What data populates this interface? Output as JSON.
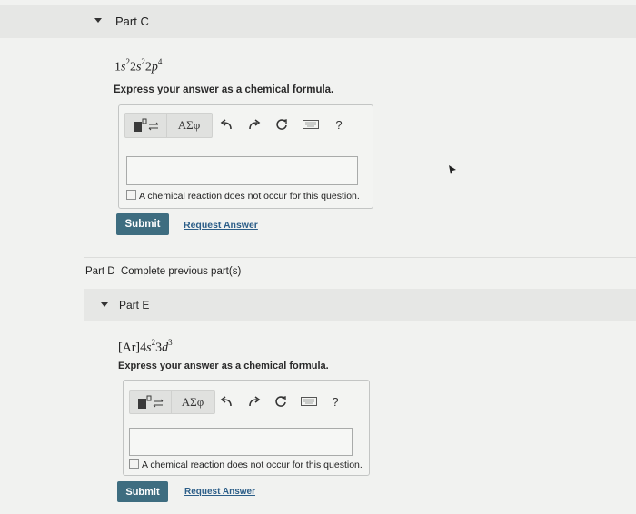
{
  "partC": {
    "title": "Part C",
    "formula": [
      "1",
      "s",
      "2",
      "2",
      "s",
      "2",
      "2",
      "p",
      "4"
    ],
    "instruction": "Express your answer as a chemical formula.",
    "checkbox_label": "A chemical reaction does not occur for this question.",
    "submit_label": "Submit",
    "request_label": "Request Answer"
  },
  "partD": {
    "title": "Part D",
    "status": "Complete previous part(s)"
  },
  "partE": {
    "title": "Part E",
    "formula": [
      "[Ar]",
      "4",
      "s",
      "2",
      "3",
      "d",
      "3"
    ],
    "instruction": "Express your answer as a chemical formula.",
    "checkbox_label": "A chemical reaction does not occur for this question.",
    "submit_label": "Submit",
    "request_label": "Request Answer"
  },
  "toolbar": {
    "greek_label": "ΑΣφ",
    "help_label": "?",
    "icons": [
      "template-icon",
      "greek-letters-icon",
      "undo-icon",
      "redo-icon",
      "reset-icon",
      "keyboard-icon",
      "help-icon"
    ]
  },
  "colors": {
    "submit_bg": "#3e6d80",
    "link": "#2c5e88",
    "band": "#e6e7e5",
    "page_bg": "#f1f2f0"
  }
}
